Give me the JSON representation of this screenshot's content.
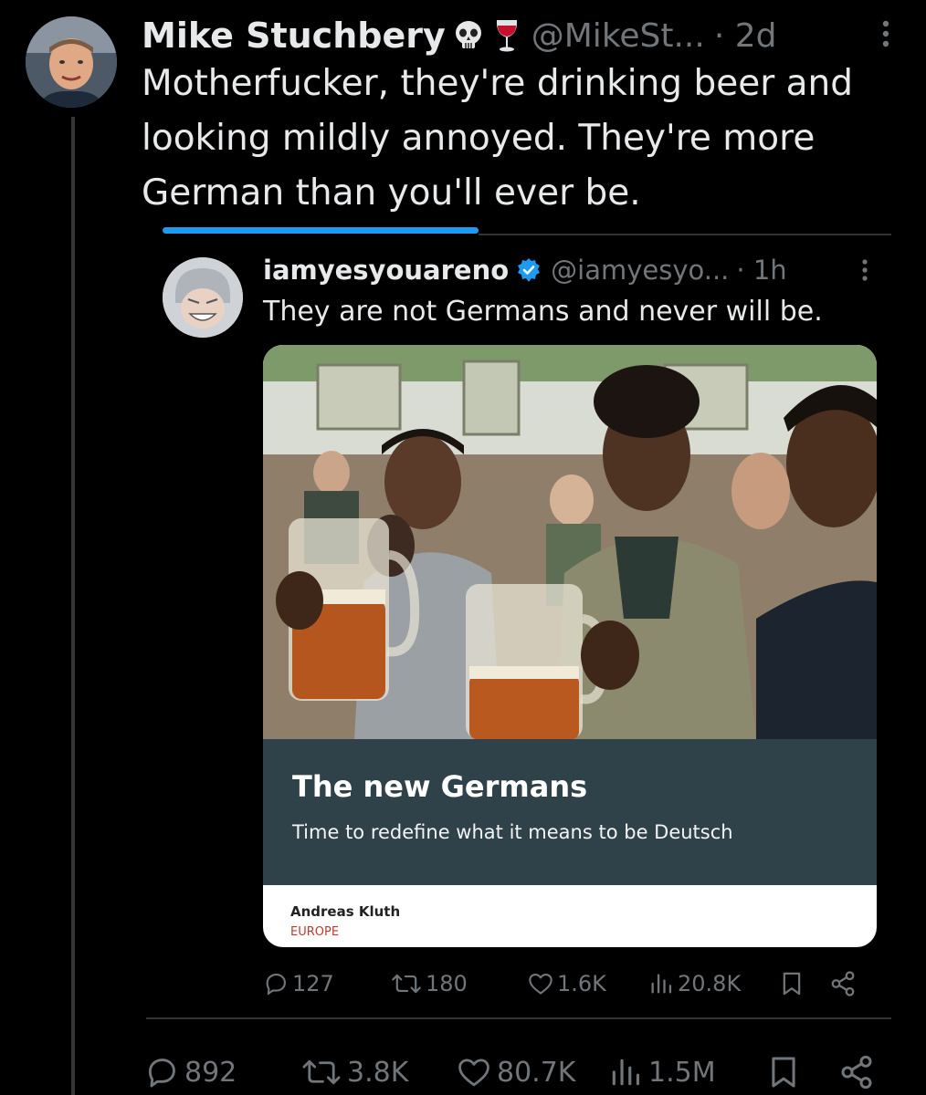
{
  "main_tweet": {
    "author_name": "Mike Stuchbery",
    "author_emojis": [
      "skull-emoji",
      "wine-glass-emoji"
    ],
    "handle": "@MikeSt...",
    "time": "· 2d",
    "text": "Motherfucker, they're drinking beer and looking mildly annoyed. They're more German than you'll ever be.",
    "stats": {
      "replies": "892",
      "retweets": "3.8K",
      "likes": "80.7K",
      "views": "1.5M"
    }
  },
  "quoted_reply": {
    "author_name": "iamyesyouareno",
    "verified": true,
    "handle": "@iamyesyo...",
    "time": "· 1h",
    "text": "They are not Germans and never will be.",
    "card": {
      "title": "The new Germans",
      "subtitle": "Time to redefine what it means to be Deutsch",
      "author": "Andreas Kluth",
      "section": "EUROPE"
    },
    "stats": {
      "replies": "127",
      "retweets": "180",
      "likes": "1.6K",
      "views": "20.8K"
    }
  },
  "colors": {
    "background": "#000000",
    "text": "#e7e9ea",
    "muted": "#71767b",
    "accent": "#1d9bf0",
    "card_band": "#2f4149",
    "section_red": "#c0392b"
  },
  "icons": [
    "more-icon",
    "verified-badge-icon",
    "reply-icon",
    "retweet-icon",
    "like-icon",
    "views-icon",
    "bookmark-icon",
    "share-icon"
  ]
}
